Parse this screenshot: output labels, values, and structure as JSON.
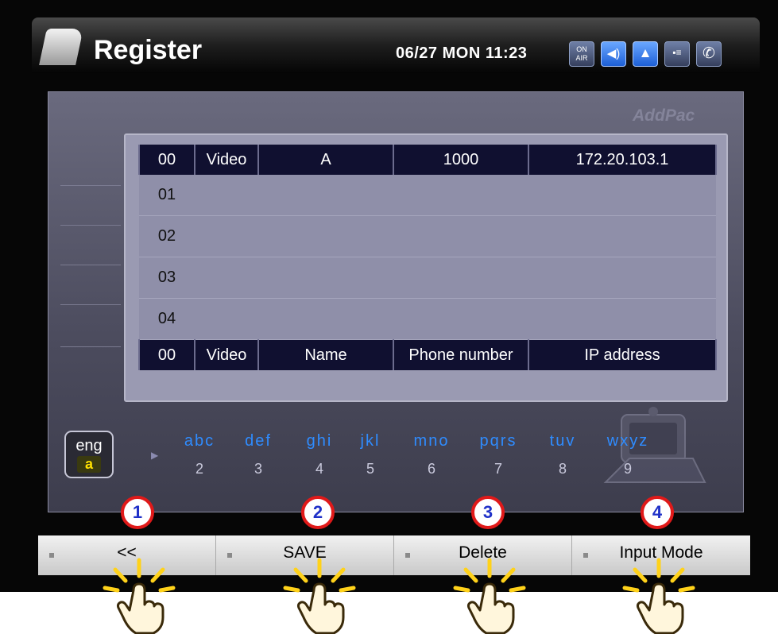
{
  "header": {
    "title": "Register",
    "datetime": "06/27 MON 11:23",
    "status_icons": [
      {
        "name": "on-air-icon",
        "label": "ON AIR",
        "active": false
      },
      {
        "name": "speaker-icon",
        "label": "◀)",
        "active": true
      },
      {
        "name": "user-icon",
        "label": "▲",
        "active": true
      },
      {
        "name": "network-icon",
        "label": "▪≡",
        "active": false
      },
      {
        "name": "handset-icon",
        "label": "✆",
        "active": false
      }
    ]
  },
  "brand": "AddPac",
  "table": {
    "top_row": [
      "00",
      "Video",
      "A",
      "1000",
      "172.20.103.1"
    ],
    "rows": [
      "01",
      "02",
      "03",
      "04"
    ],
    "header_row": [
      "00",
      "Video",
      "Name",
      "Phone number",
      "IP address"
    ]
  },
  "input_mode": {
    "line1": "eng",
    "line2": "a"
  },
  "keypad": [
    {
      "letters": "abc",
      "digit": "2"
    },
    {
      "letters": "def",
      "digit": "3"
    },
    {
      "letters": "ghi",
      "digit": "4"
    },
    {
      "letters": "jkl",
      "digit": "5"
    },
    {
      "letters": "mno",
      "digit": "6"
    },
    {
      "letters": "pqrs",
      "digit": "7"
    },
    {
      "letters": "tuv",
      "digit": "8"
    },
    {
      "letters": "wxyz",
      "digit": "9"
    }
  ],
  "softkeys": [
    {
      "label": "<<",
      "callout": "1"
    },
    {
      "label": "SAVE",
      "callout": "2"
    },
    {
      "label": "Delete",
      "callout": "3"
    },
    {
      "label": "Input Mode",
      "callout": "4"
    }
  ],
  "colors": {
    "callout_border": "#e01919",
    "callout_text": "#1f30c8",
    "keypad_letters": "#2f8cff",
    "hand_rays": "#ffd21a"
  }
}
